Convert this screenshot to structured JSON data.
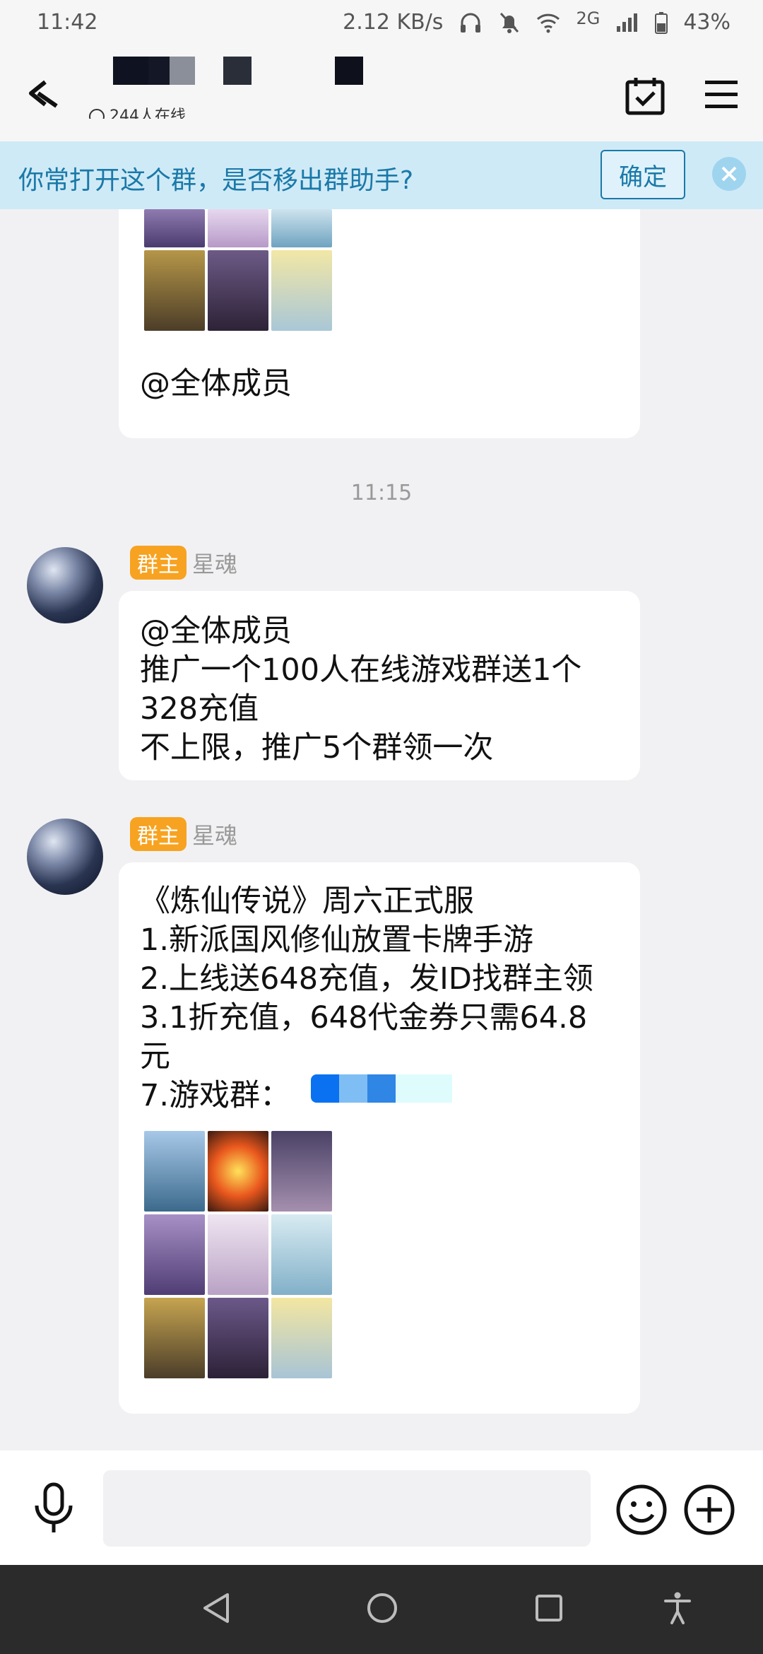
{
  "status_bar": {
    "time": "11:42",
    "speed": "2.12 KB/s",
    "network": "2G",
    "battery": "43%"
  },
  "header": {
    "online_count": "244人在线"
  },
  "banner": {
    "text": "你常打开这个群，是否移出群助手?",
    "confirm_label": "确定"
  },
  "messages": [
    {
      "text": "@全体成员"
    },
    {
      "timestamp": "11:15"
    },
    {
      "badge": "群主",
      "sender": "星魂",
      "text": "@全体成员\n推广一个100人在线游戏群送1个\n328充值\n不上限，推广5个群领一次"
    },
    {
      "badge": "群主",
      "sender": "星魂",
      "text": "《炼仙传说》周六正式服\n1.新派国风修仙放置卡牌手游\n2.上线送648充值，发ID找群主领\n3.1折充值，648代金券只需64.8\n元\n7.游戏群："
    }
  ],
  "colors": {
    "accent": "#1a79a8",
    "banner_bg": "#cfeaf7",
    "owner_badge": "#f7a321"
  },
  "icons": [
    "back-icon",
    "calendar-check-icon",
    "menu-icon",
    "microphone-icon",
    "emoji-icon",
    "plus-icon",
    "nav-back-icon",
    "nav-home-icon",
    "nav-recents-icon",
    "accessibility-icon"
  ]
}
